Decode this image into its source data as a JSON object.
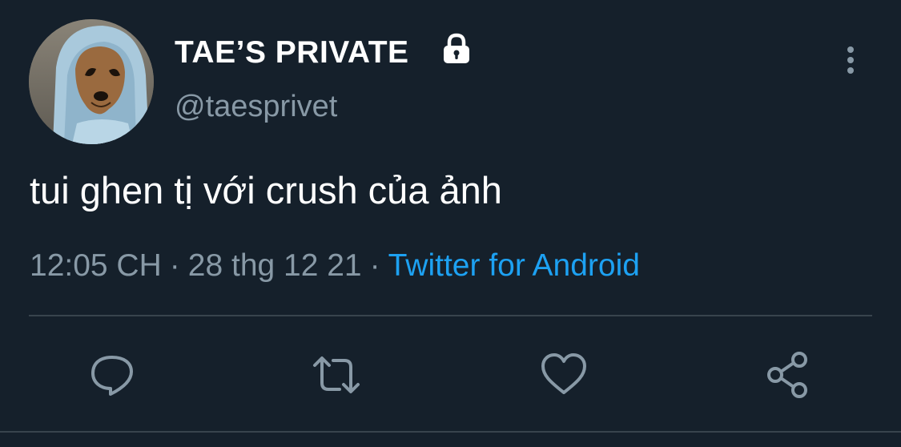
{
  "tweet": {
    "display_name": "TAE’S PRIVATE",
    "handle": "@taesprivet",
    "text": "tui ghen tị với crush của ảnh",
    "time": "12:05 CH",
    "date": "28 thg 12 21",
    "separator": "·",
    "source": "Twitter for Android",
    "protected_icon": "lock-icon",
    "avatar_alt": "avatar"
  },
  "actions": {
    "reply_icon": "reply-icon",
    "retweet_icon": "retweet-icon",
    "like_icon": "heart-icon",
    "share_icon": "share-icon"
  },
  "colors": {
    "background": "#15202b",
    "primary_text": "#ffffff",
    "secondary_text": "#8899a6",
    "accent": "#1da1f2",
    "divider": "#38444d"
  }
}
